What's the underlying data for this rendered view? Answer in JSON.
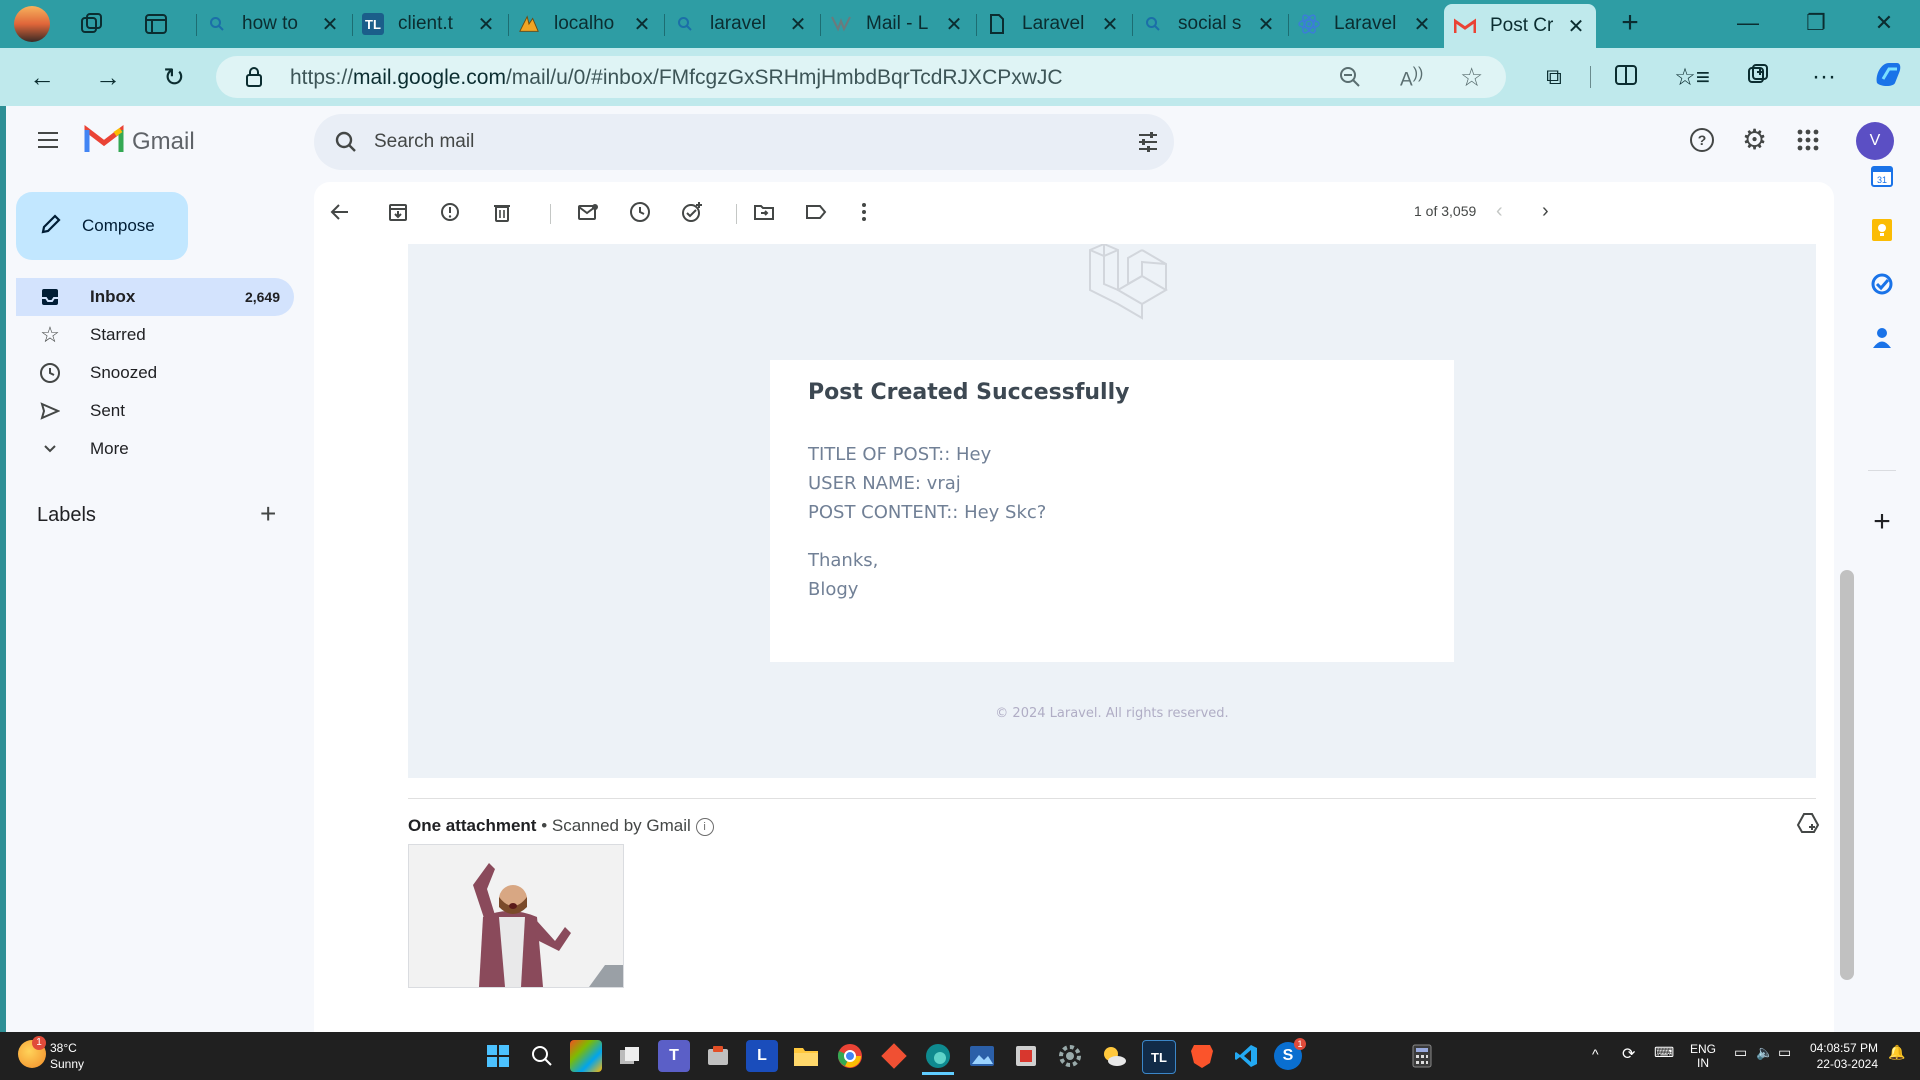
{
  "browser": {
    "tabs": [
      {
        "label": "how to",
        "icon": "search-icon"
      },
      {
        "label": "client.t",
        "icon": "tl-icon",
        "icon_text": "TL"
      },
      {
        "label": "localho",
        "icon": "phpmyadmin-icon"
      },
      {
        "label": "laravel",
        "icon": "search-icon"
      },
      {
        "label": "Mail - L",
        "icon": "mail-icon"
      },
      {
        "label": "Laravel",
        "icon": "document-icon"
      },
      {
        "label": "social s",
        "icon": "search-icon"
      },
      {
        "label": "Laravel",
        "icon": "react-icon"
      },
      {
        "label": "Post Cr",
        "icon": "gmail-icon",
        "active": true
      }
    ],
    "url_prefix": "https://",
    "url_domain": "mail.google.com",
    "url_path": "/mail/u/0/#inbox/FMfcgzGxSRHmjHmbdBqrTcdRJXCPxwJC",
    "copilot_color": "#1a73e8"
  },
  "gmail": {
    "brand": "Gmail",
    "search_placeholder": "Search mail",
    "avatar_letter": "V",
    "avatar_color": "#5b4fc4",
    "compose_label": "Compose",
    "nav": [
      {
        "label": "Inbox",
        "count": "2,649",
        "icon": "inbox-icon",
        "active": true
      },
      {
        "label": "Starred",
        "count": "",
        "icon": "star-icon"
      },
      {
        "label": "Snoozed",
        "count": "",
        "icon": "clock-icon"
      },
      {
        "label": "Sent",
        "count": "",
        "icon": "send-icon"
      },
      {
        "label": "More",
        "count": "",
        "icon": "chevron-down-icon"
      }
    ],
    "labels_heading": "Labels",
    "pager": "1 of 3,059",
    "email": {
      "heading": "Post Created Successfully",
      "lines": [
        "TITLE OF POST:: Hey",
        "USER NAME: vraj",
        "POST CONTENT:: Hey Skc?"
      ],
      "sign_thanks": "Thanks,",
      "sign_name": "Blogy",
      "footer": "© 2024 Laravel. All rights reserved."
    },
    "attachment": {
      "title": "One attachment",
      "scanned": "• Scanned by Gmail"
    }
  },
  "taskbar": {
    "weather_temp": "38°C",
    "weather_desc": "Sunny",
    "weather_badge": "1",
    "lang_top": "ENG",
    "lang_bottom": "IN",
    "time": "04:08:57 PM",
    "date": "22-03-2024",
    "skype_badge": "1"
  }
}
